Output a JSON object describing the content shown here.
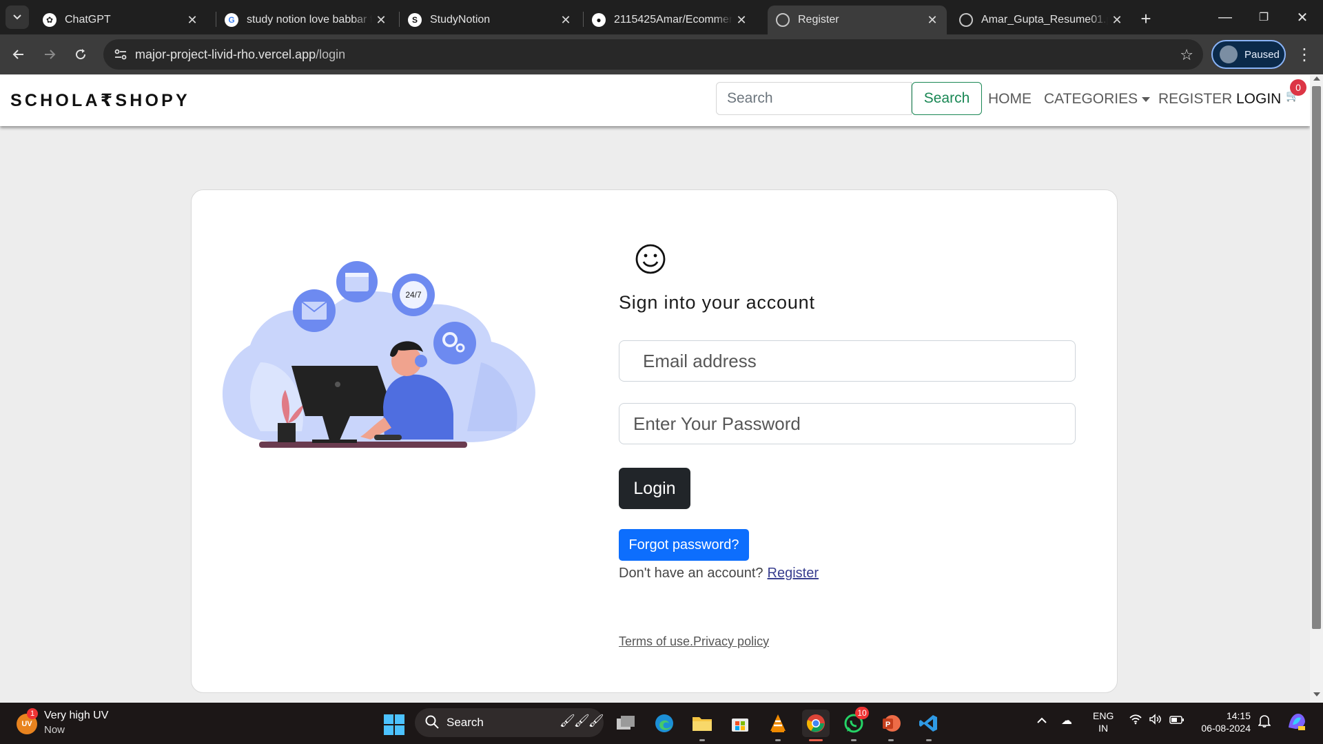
{
  "browser": {
    "tabs": [
      {
        "title": "ChatGPT",
        "icon": "chatgpt-icon"
      },
      {
        "title": "study notion love babbar f",
        "icon": "google-icon"
      },
      {
        "title": "StudyNotion",
        "icon": "studynotion-icon"
      },
      {
        "title": "2115425Amar/Ecommerce",
        "icon": "github-icon"
      },
      {
        "title": "Register",
        "icon": "globe-icon",
        "active": true
      },
      {
        "title": "Amar_Gupta_Resume01.pd",
        "icon": "globe-icon"
      }
    ],
    "url_host": "major-project-livid-rho.vercel.app",
    "url_path": "/login",
    "profile_label": "Paused"
  },
  "site": {
    "brand": "SCHOLA₹SHOPY",
    "search_placeholder": "Search",
    "search_button": "Search",
    "nav": {
      "home": "HOME",
      "categories": "CATEGORIES",
      "register": "REGISTER",
      "login": "LOGIN"
    },
    "cart_count": "0"
  },
  "login": {
    "icon_glyph": "☺",
    "heading": "Sign into your account",
    "email_placeholder": "Email address",
    "password_placeholder": "Enter Your Password",
    "login_button": "Login",
    "forgot_button": "Forgot password?",
    "signup_prompt": "Don't have an account?",
    "signup_link": "Register",
    "terms": "Terms of use.",
    "privacy": "Privacy policy",
    "illustration_badge": "24/7"
  },
  "taskbar": {
    "weather_title": "Very high UV",
    "weather_sub": "Now",
    "weather_icon_text": "UV",
    "weather_badge": "1",
    "search_label": "Search",
    "whatsapp_badge": "10",
    "lang_top": "ENG",
    "lang_bottom": "IN",
    "time": "14:15",
    "date": "06-08-2024"
  },
  "colors": {
    "accent_green": "#198754",
    "primary_blue": "#0d6efd",
    "dark_button": "#212529",
    "badge_red": "#dc3545"
  }
}
